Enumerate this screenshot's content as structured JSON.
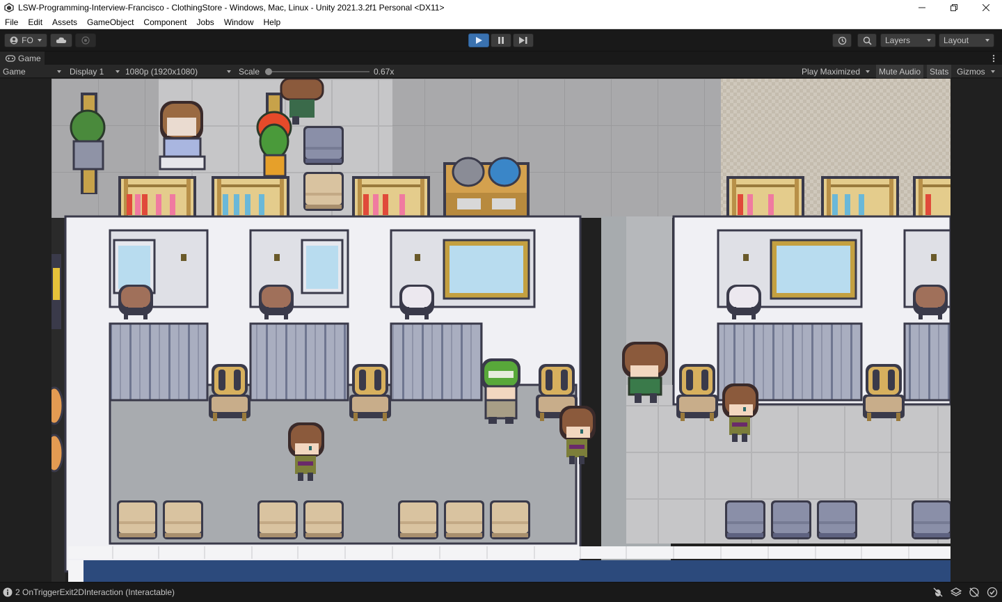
{
  "window": {
    "title": "LSW-Programming-Interview-Francisco - ClothingStore - Windows, Mac, Linux - Unity 2021.3.2f1 Personal <DX11>",
    "controls": [
      "minimize",
      "maximize",
      "close"
    ]
  },
  "menu": [
    "File",
    "Edit",
    "Assets",
    "GameObject",
    "Component",
    "Jobs",
    "Window",
    "Help"
  ],
  "toolbar": {
    "account_label": "FO",
    "layers_label": "Layers",
    "layout_label": "Layout"
  },
  "game_tab": {
    "label": "Game"
  },
  "game_controls": {
    "mode": "Game",
    "display": "Display 1",
    "resolution": "1080p (1920x1080)",
    "scale_label": "Scale",
    "scale_value": "0.67x",
    "play_mode": "Play Maximized",
    "mute_audio": "Mute Audio",
    "stats": "Stats",
    "gizmos": "Gizmos"
  },
  "status": {
    "message": "2 OnTriggerExit2DInteraction (Interactable)"
  },
  "colors": {
    "editor_bg": "#191919",
    "panel_bg": "#282828",
    "play_active": "#3a72b0",
    "floor_gray": "#a8a8a8",
    "counter_white": "#f2f2f4",
    "outline": "#3a3a4a",
    "navy_wall": "#2c4a7c"
  }
}
